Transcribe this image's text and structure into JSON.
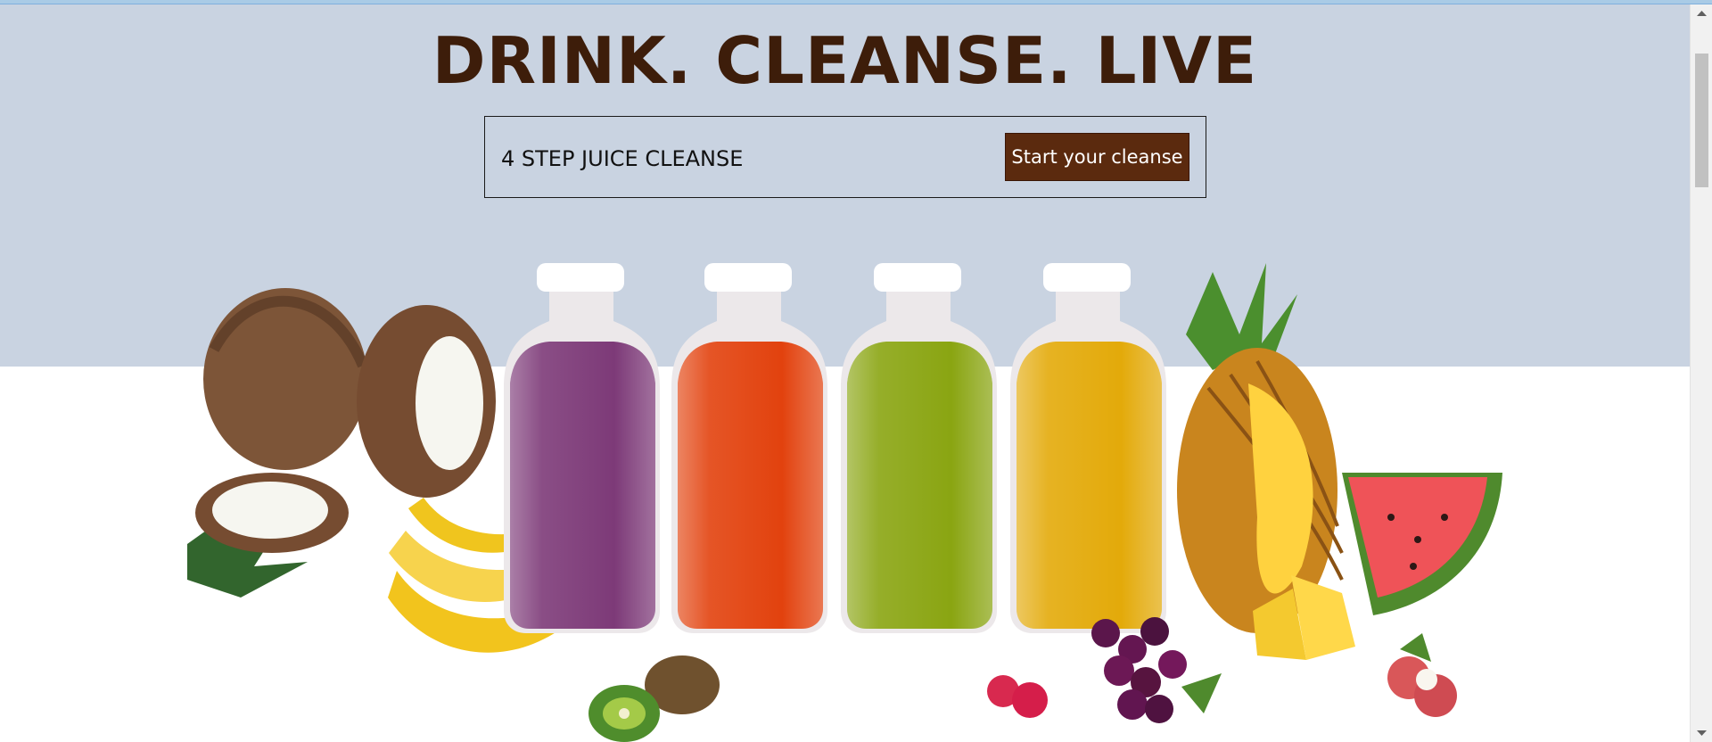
{
  "hero": {
    "headline": "DRINK. CLEANSE. LIVE",
    "cleanse_label": "4 STEP JUICE CLEANSE",
    "button_label": "Start your cleanse",
    "image_description_icon": "juice-bottles-with-fruit-image"
  },
  "juice_bottles": [
    {
      "flavor": "purple",
      "color": "#7d3a78"
    },
    {
      "flavor": "orange",
      "color": "#e2420e"
    },
    {
      "flavor": "green",
      "color": "#8aa512"
    },
    {
      "flavor": "yellow",
      "color": "#e3aa0a"
    }
  ],
  "colors": {
    "hero_background": "#c9d3e1",
    "headline": "#3d1d0a",
    "button_background": "#5b2a0e",
    "page_background": "#ffffff"
  },
  "scrollbar": {
    "up_icon": "chevron-up-icon",
    "down_icon": "chevron-down-icon"
  }
}
